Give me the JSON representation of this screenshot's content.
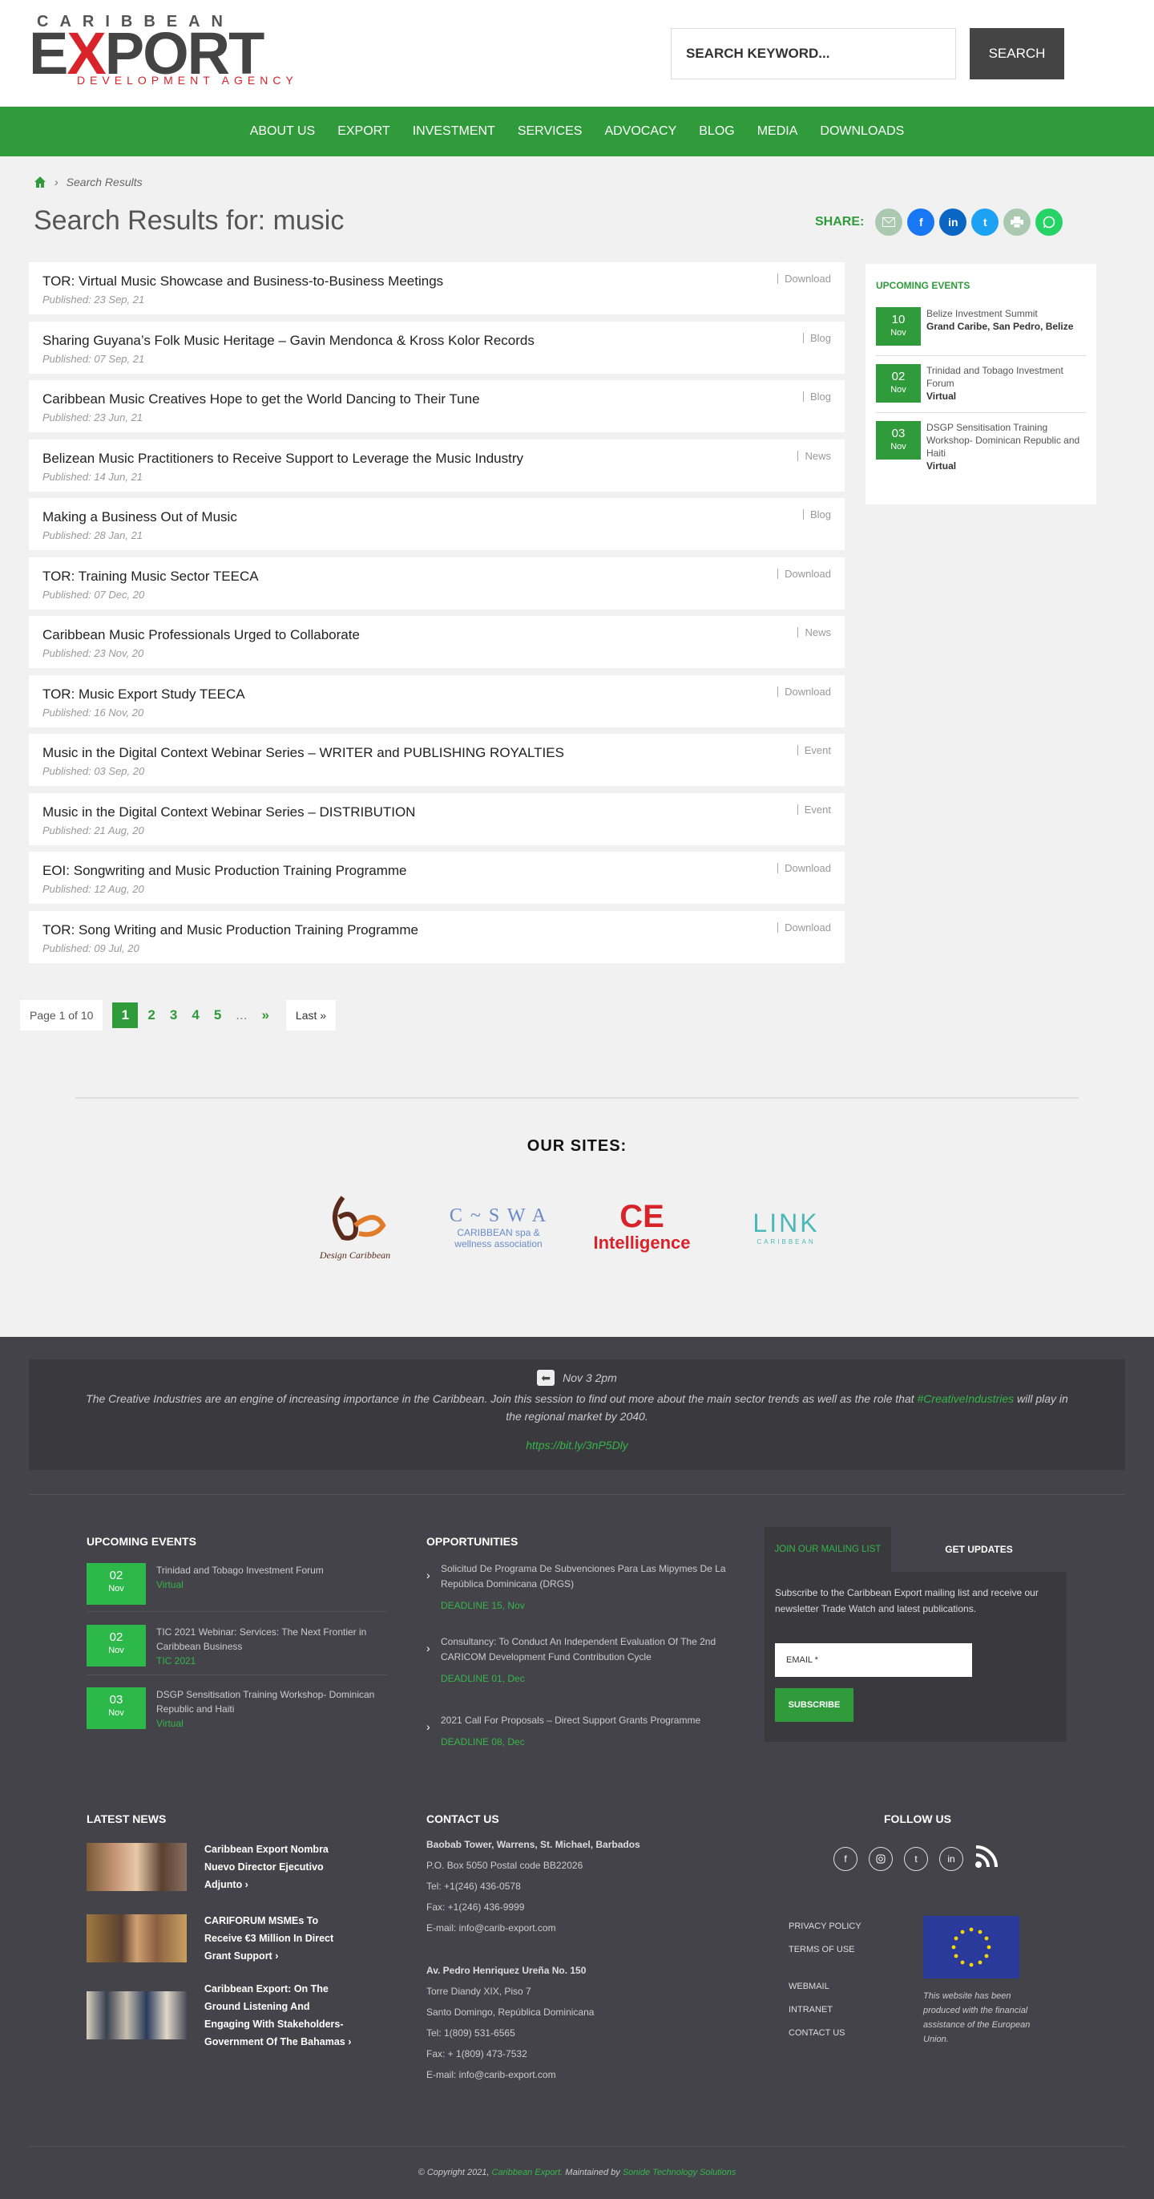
{
  "header": {
    "logo": {
      "top": "CARIBBEAN",
      "main_1": "E",
      "main_x": "X",
      "main_2": "PORT",
      "sub": "DEVELOPMENT AGENCY"
    },
    "search_placeholder": "SEARCH KEYWORD...",
    "search_button": "SEARCH"
  },
  "nav": [
    "ABOUT US",
    "EXPORT",
    "INVESTMENT",
    "SERVICES",
    "ADVOCACY",
    "BLOG",
    "MEDIA",
    "DOWNLOADS"
  ],
  "breadcrumb": {
    "sep": "›",
    "current": "Search Results"
  },
  "page_title": "Search Results for: music",
  "share": {
    "label": "SHARE:",
    "icons": [
      "email-icon",
      "facebook-icon",
      "linkedin-icon",
      "twitter-icon",
      "print-icon",
      "whatsapp-icon"
    ],
    "colors": [
      "#aaa",
      "#1877f2",
      "#0a66c2",
      "#1da1f2",
      "#aaa",
      "#25d366"
    ]
  },
  "results": [
    {
      "title": "TOR: Virtual Music Showcase and Business-to-Business Meetings",
      "date": "Published: 23 Sep, 21",
      "type": "Download"
    },
    {
      "title": "Sharing Guyana’s Folk Music Heritage – Gavin Mendonca & Kross Kolor Records",
      "date": "Published: 07 Sep, 21",
      "type": "Blog"
    },
    {
      "title": "Caribbean Music Creatives Hope to get the World Dancing to Their Tune",
      "date": "Published: 23 Jun, 21",
      "type": "Blog"
    },
    {
      "title": "Belizean Music Practitioners to Receive Support to Leverage the Music Industry",
      "date": "Published: 14 Jun, 21",
      "type": "News"
    },
    {
      "title": "Making a Business Out of Music",
      "date": "Published: 28 Jan, 21",
      "type": "Blog"
    },
    {
      "title": "TOR: Training Music Sector TEECA",
      "date": "Published: 07 Dec, 20",
      "type": "Download"
    },
    {
      "title": "Caribbean Music Professionals Urged to Collaborate",
      "date": "Published: 23 Nov, 20",
      "type": "News"
    },
    {
      "title": "TOR: Music Export Study TEECA",
      "date": "Published: 16 Nov, 20",
      "type": "Download"
    },
    {
      "title": "Music in the Digital Context Webinar Series – WRITER and PUBLISHING ROYALTIES",
      "date": "Published: 03 Sep, 20",
      "type": "Event"
    },
    {
      "title": "Music in the Digital Context Webinar Series – DISTRIBUTION",
      "date": "Published: 21 Aug, 20",
      "type": "Event"
    },
    {
      "title": "EOI: Songwriting and Music Production Training Programme",
      "date": "Published: 12 Aug, 20",
      "type": "Download"
    },
    {
      "title": "TOR: Song Writing and Music Production Training Programme",
      "date": "Published: 09 Jul, 20",
      "type": "Download"
    }
  ],
  "sidebar": {
    "title": "UPCOMING EVENTS",
    "events": [
      {
        "day": "10",
        "month": "Nov",
        "title": "Belize Investment Summit",
        "location": "Grand Caribe, San Pedro, Belize"
      },
      {
        "day": "02",
        "month": "Nov",
        "title": "Trinidad and Tobago Investment Forum",
        "location": "Virtual"
      },
      {
        "day": "03",
        "month": "Nov",
        "title": "DSGP Sensitisation Training Workshop- Dominican Republic and Haiti",
        "location": "Virtual"
      }
    ]
  },
  "pagination": {
    "info": "Page 1 of 10",
    "current": "1",
    "pages": [
      "2",
      "3",
      "4",
      "5"
    ],
    "ellipsis": "...",
    "next": "»",
    "last": "Last »"
  },
  "our_sites": {
    "title": "OUR SITES:",
    "sites": [
      {
        "name": "Design Caribbean",
        "label": "Design Caribbean"
      },
      {
        "name": "C~SWA",
        "label": "C ~ S W A",
        "sub": "CARIBBEAN spa & wellness association"
      },
      {
        "name": "CE Intelligence",
        "label": "CE",
        "sub": "Intelligence"
      },
      {
        "name": "LINK",
        "label": "LINK",
        "sub": "CARIBBEAN"
      }
    ]
  },
  "footer": {
    "tweet": {
      "time": "Nov 3 2pm",
      "text_1": "The Creative Industries are an engine of increasing importance in the Caribbean. Join this session to find out more about the main sector trends as well as the role that",
      "hashtag": "#CreativeIndustries",
      "text_2": "will play in the regional market by 2040.",
      "link": "https://bit.ly/3nP5Dly"
    },
    "events_title": "UPCOMING EVENTS",
    "events": [
      {
        "day": "02",
        "month": "Nov",
        "title": "Trinidad and Tobago Investment Forum",
        "location": "Virtual"
      },
      {
        "day": "02",
        "month": "Nov",
        "title": "TIC 2021 Webinar: Services: The Next Frontier in Caribbean Business",
        "location": "TIC 2021"
      },
      {
        "day": "03",
        "month": "Nov",
        "title": "DSGP Sensitisation Training Workshop- Dominican Republic and Haiti",
        "location": "Virtual"
      }
    ],
    "opp_title": "OPPORTUNITIES",
    "opportunities": [
      {
        "title": "Solicitud De Programa De Subvenciones Para Las Mipymes De La República Dominicana (DRGS)",
        "deadline": "DEADLINE  15, Nov"
      },
      {
        "title": "Consultancy: To Conduct An Independent Evaluation Of The 2nd CARICOM Development Fund Contribution Cycle",
        "deadline": "DEADLINE  01, Dec"
      },
      {
        "title": "2021 Call For Proposals – Direct Support Grants Programme",
        "deadline": "DEADLINE  08, Dec"
      }
    ],
    "mailing": {
      "tab_join": "JOIN OUR MAILING LIST",
      "tab_get": "GET UPDATES",
      "text": "Subscribe to the Caribbean Export mailing list and receive our newsletter Trade Watch and latest publications.",
      "email_placeholder": "EMAIL *",
      "subscribe": "SUBSCRIBE"
    },
    "news_title": "LATEST NEWS",
    "news": [
      {
        "title": "Caribbean Export Nombra Nuevo Director Ejecutivo Adjunto  ›"
      },
      {
        "title": "CARIFORUM MSMEs To Receive €3 Million In Direct Grant Support  ›"
      },
      {
        "title": "Caribbean Export: On The Ground Listening And Engaging With Stakeholders- Government Of The Bahamas  ›"
      }
    ],
    "contact_title": "CONTACT US",
    "contact": [
      {
        "head": "Baobab Tower, Warrens, St. Michael, Barbados",
        "lines": [
          "P.O. Box 5050   Postal code BB22026",
          "Tel: +1(246) 436-0578",
          "Fax: +1(246) 436-9999",
          "E-mail: info@carib-export.com"
        ]
      },
      {
        "head": "Av. Pedro Henriquez Ureña No. 150",
        "lines": [
          "Torre Diandy XIX, Piso 7",
          "Santo Domingo, República Dominicana",
          "Tel: 1(809) 531-6565",
          "Fax: + 1(809) 473-7532",
          "E-mail: info@carib-export.com"
        ]
      }
    ],
    "follow_title": "FOLLOW US",
    "social": [
      "facebook-icon",
      "instagram-icon",
      "twitter-icon",
      "linkedin-icon",
      "rss-icon"
    ],
    "links_1": [
      "PRIVACY POLICY",
      "TERMS OF USE"
    ],
    "links_2": [
      "WEBMAIL",
      "INTRANET",
      "CONTACT US"
    ],
    "eu_text": "This website has been produced with the financial assistance of the European Union.",
    "copyright": {
      "text_1": "© Copyright 2021,",
      "brand": "Caribbean Export.",
      "text_2": "Maintained by",
      "maint": "Sonide Technology Solutions"
    }
  }
}
